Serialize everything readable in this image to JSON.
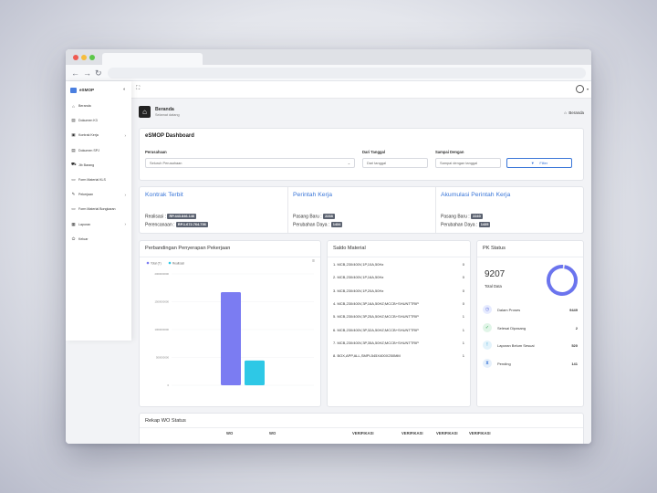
{
  "brand": {
    "name": "eSMOP"
  },
  "sidebar": {
    "items": [
      {
        "label": "Beranda",
        "icon": "home-icon",
        "has_children": false
      },
      {
        "label": "Dokumen K3",
        "icon": "document-icon",
        "has_children": false
      },
      {
        "label": "Kontrak Kerja",
        "icon": "briefcase-icon",
        "has_children": true
      },
      {
        "label": "Dokumen SPJ",
        "icon": "document-icon",
        "has_children": false
      },
      {
        "label": "Jib Barang",
        "icon": "truck-icon",
        "has_children": false
      },
      {
        "label": "Form Material KLS",
        "icon": "form-icon",
        "has_children": false
      },
      {
        "label": "Pekerjaan",
        "icon": "tools-icon",
        "has_children": true
      },
      {
        "label": "Form Material Bongkaran",
        "icon": "form-icon",
        "has_children": false
      },
      {
        "label": "Laporan",
        "icon": "report-icon",
        "has_children": true
      },
      {
        "label": "Keluar",
        "icon": "power-icon",
        "has_children": false
      }
    ]
  },
  "header": {
    "title": "Beranda",
    "subtitle": "Selamat datang",
    "breadcrumb": "Beranda"
  },
  "dashboard": {
    "title": "eSMOP Dashboard",
    "perusahaan_label": "Perusahaan",
    "perusahaan_value": "Seluruh Perusahaan",
    "dari_label": "Dari Tanggal",
    "dari_placeholder": "Dari tanggal",
    "sampai_label": "Sampai Dengan",
    "sampai_placeholder": "Sampai dengan tanggal",
    "filter_label": "Filter"
  },
  "stats": {
    "kontrak": {
      "title": "Kontrak Terbit",
      "realisasi_label": "Realisasi :",
      "realisasi_value": "RP.443.846.146",
      "perencanaan_label": "Perencanaan :",
      "perencanaan_value": "RP.1.672.764.736"
    },
    "perintah": {
      "title": "Perintah Kerja",
      "pasang_label": "Pasang Baru :",
      "pasang_value": "2238",
      "ubah_label": "Perubahan Daya :",
      "ubah_value": "1434"
    },
    "akumulasi": {
      "title": "Akumulasi Perintah Kerja",
      "pasang_label": "Pasang Baru :",
      "pasang_value": "2240",
      "ubah_label": "Perubahan Daya :",
      "ubah_value": "1435"
    }
  },
  "chart_panel": {
    "title": "Perbandingan Penyerapan Pekerjaan",
    "menu_icon": "hamburger-icon"
  },
  "chart_data": {
    "type": "bar",
    "series": [
      {
        "name": "Total (T)",
        "value": 1672764736,
        "color": "#7b7cf2"
      },
      {
        "name": "Realisasi",
        "value": 443846146,
        "color": "#2ec8e6"
      }
    ],
    "ylim": [
      0,
      2000000000
    ],
    "y_ticks": [
      "2000000000",
      "1500000000",
      "1000000000",
      "500000000",
      "0"
    ]
  },
  "material": {
    "title": "Saldo Material",
    "items": [
      {
        "name": "1. MCB,230/400V,1P,10A,50Hz",
        "value": "0"
      },
      {
        "name": "2. MCB,230/400V,1P,16A,50Hz",
        "value": "0"
      },
      {
        "name": "3. MCB,230/400V,1P,20A,50Hz",
        "value": "0"
      },
      {
        "name": "4. MCB,230/400V,3P,16A,50HZ;MCCB+SHUNTTRIP",
        "value": "0"
      },
      {
        "name": "5. MCB,230/400V,3P,25A,50HZ;MCCB+SHUNTTRIP",
        "value": "1"
      },
      {
        "name": "6. MCB,230/400V,3P,32A,50HZ;MCCB+SHUNTTRIP",
        "value": "1"
      },
      {
        "name": "7. MCB,230/400V,3P,35A,50HZ;MCCB+SHUNTTRIP",
        "value": "1"
      },
      {
        "name": "8. BOX,APP,ALL,SMPL545X400X250MM",
        "value": "1"
      }
    ]
  },
  "pk_status": {
    "title": "PK Status",
    "total": "9207",
    "total_label": "Total Data",
    "donut_done_fraction": 0.98,
    "items": [
      {
        "label": "Dalam Proses",
        "value": "9449",
        "icon": "clock-icon",
        "color": "#e6ebff",
        "fg": "#5b6ad8"
      },
      {
        "label": "Selesai Dipasang",
        "value": "2",
        "icon": "check-icon",
        "color": "#e1f5e8",
        "fg": "#34a853"
      },
      {
        "label": "Laporan Belum Sesuai",
        "value": "520",
        "icon": "alert-icon",
        "color": "#e3f3fb",
        "fg": "#2a9fd6"
      },
      {
        "label": "Pending",
        "value": "141",
        "icon": "hourglass-icon",
        "color": "#e6f0fb",
        "fg": "#3a76d8"
      }
    ]
  },
  "wo_status": {
    "title": "Rekap WO Status",
    "columns": [
      "WO",
      "WO",
      "VERIFIKASI",
      "VERIFIKASI",
      "VERIFIKASI",
      "VERIFIKASI"
    ]
  }
}
